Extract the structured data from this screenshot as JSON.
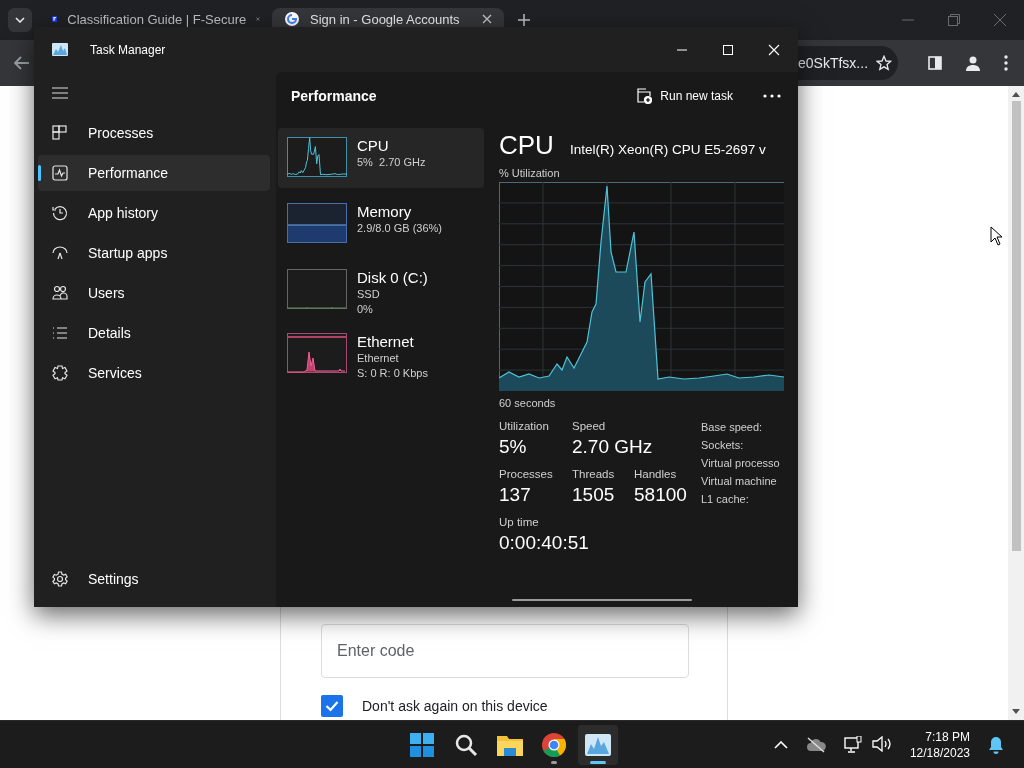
{
  "browser": {
    "tabs": [
      {
        "title": "Classification Guide | F-Secure",
        "selected": false
      },
      {
        "title": "Sign in - Google Accounts",
        "selected": true
      }
    ],
    "address": "e0SkTfsx..."
  },
  "page": {
    "code_field": {
      "placeholder": "Enter code"
    },
    "remember": {
      "label": "Don't ask again on this device",
      "checked": true
    }
  },
  "task_manager": {
    "title": "Task Manager",
    "nav": [
      {
        "label": "Processes",
        "selected": false
      },
      {
        "label": "Performance",
        "selected": true
      },
      {
        "label": "App history",
        "selected": false
      },
      {
        "label": "Startup apps",
        "selected": false
      },
      {
        "label": "Users",
        "selected": false
      },
      {
        "label": "Details",
        "selected": false
      },
      {
        "label": "Services",
        "selected": false
      }
    ],
    "settings": "Settings",
    "header": "Performance",
    "run_task": "Run new task",
    "devices": [
      {
        "kind": "cpu",
        "name": "CPU",
        "details": [
          "5%  2.70 GHz"
        ],
        "selected": true
      },
      {
        "kind": "memory",
        "name": "Memory",
        "details": [
          "2.9/8.0 GB (36%)"
        ],
        "selected": false
      },
      {
        "kind": "disk",
        "name": "Disk 0 (C:)",
        "details": [
          "SSD",
          "0%"
        ],
        "selected": false
      },
      {
        "kind": "ethernet",
        "name": "Ethernet",
        "details": [
          "Ethernet",
          "S: 0 R: 0 Kbps"
        ],
        "selected": false
      }
    ],
    "detail": {
      "name": "CPU",
      "model": "Intel(R) Xeon(R) CPU E5-2697 v",
      "graph_label": "% Utilization",
      "time_span": "60 seconds",
      "stat_rows": [
        [
          {
            "label": "Utilization",
            "value": "5%"
          },
          {
            "label": "Speed",
            "value": "2.70 GHz"
          }
        ],
        [
          {
            "label": "Processes",
            "value": "137"
          },
          {
            "label": "Threads",
            "value": "1505"
          },
          {
            "label": "Handles",
            "value": "58100"
          }
        ],
        [
          {
            "label": "Up time",
            "value": "0:00:40:51"
          }
        ]
      ],
      "specs": [
        "Base speed:",
        "Sockets:",
        "Virtual processo",
        "Virtual machine",
        "L1 cache:"
      ]
    }
  },
  "taskbar": {
    "apps": [
      {
        "running": false,
        "active": false
      },
      {
        "running": false,
        "active": false
      },
      {
        "running": false,
        "active": false
      },
      {
        "running": true,
        "active": false
      },
      {
        "running": true,
        "active": true
      }
    ],
    "time": "7:18 PM",
    "date": "12/18/2023"
  }
}
